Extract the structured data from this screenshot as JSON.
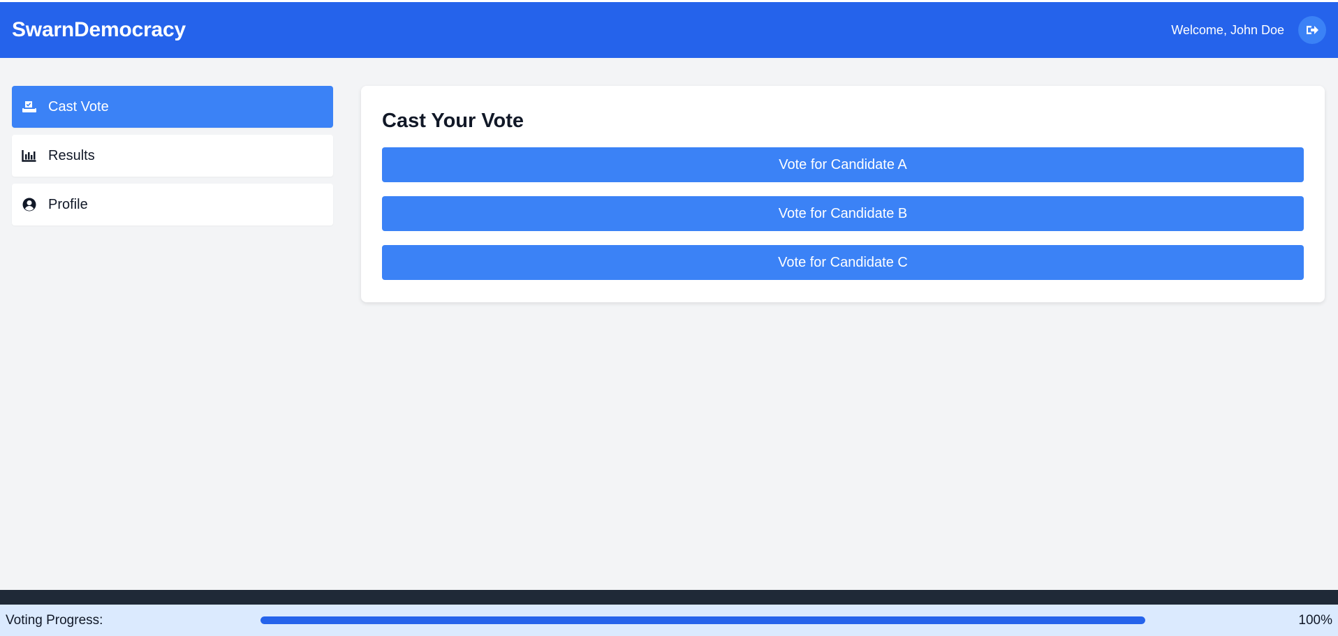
{
  "header": {
    "brand": "SwarnDemocracy",
    "welcome_text": "Welcome, John Doe",
    "logout_icon": "sign-out-icon"
  },
  "sidebar": {
    "items": [
      {
        "label": "Cast Vote",
        "icon": "ballot-box-icon",
        "active": true
      },
      {
        "label": "Results",
        "icon": "bar-chart-icon",
        "active": false
      },
      {
        "label": "Profile",
        "icon": "user-circle-icon",
        "active": false
      }
    ]
  },
  "main": {
    "title": "Cast Your Vote",
    "buttons": [
      "Vote for Candidate A",
      "Vote for Candidate B",
      "Vote for Candidate C"
    ]
  },
  "footer": {
    "progress_label": "Voting Progress:",
    "progress_value": "100%",
    "progress_fraction": 1.0
  },
  "colors": {
    "header": "#2563eb",
    "accent": "#3b82f6",
    "background": "#f3f4f6",
    "footer_dark": "#1f2937",
    "footer_bar": "#dbeafe"
  }
}
